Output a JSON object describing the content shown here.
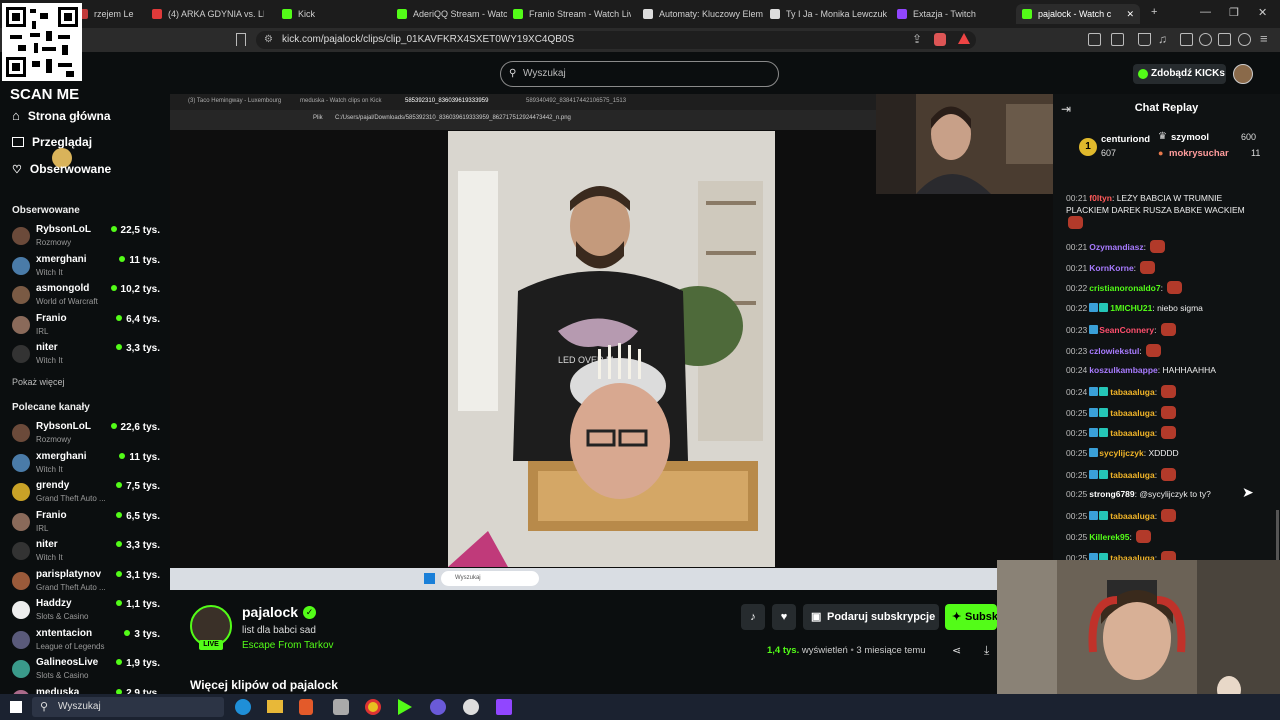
{
  "browser": {
    "tabs": [
      {
        "label": "rzejem Le",
        "color": "#c13b3b"
      },
      {
        "label": "(4) ARKA GDYNIA vs. LECH",
        "color": "#e03a3a"
      },
      {
        "label": "Kick",
        "color": "#53fc18"
      },
      {
        "label": "AderiQQ Stream - Watch L",
        "color": "#53fc18"
      },
      {
        "label": "Franio Stream - Watch Liv",
        "color": "#53fc18"
      },
      {
        "label": "Automaty: Kluczowy Elem",
        "color": "#dddddd"
      },
      {
        "label": "Ty I Ja - Monika Lewczuk",
        "color": "#dddddd"
      },
      {
        "label": "Extazja - Twitch",
        "color": "#9146ff"
      },
      {
        "label": "pajalock - Watch c",
        "color": "#53fc18"
      }
    ],
    "url": "kick.com/pajalock/clips/clip_01KAVFKRX4SXET0WY19XC4QB0S"
  },
  "overlay": {
    "scan_label": "SCAN ME"
  },
  "sidebar": {
    "nav": [
      {
        "label": "Strona główna"
      },
      {
        "label": "Przeglądaj"
      },
      {
        "label": "Obserwowane"
      }
    ],
    "followed_title": "Obserwowane",
    "followed": [
      {
        "name": "RybsonLoL",
        "game": "Rozmowy",
        "count": "22,5 tys.",
        "color": "#6b4a3a"
      },
      {
        "name": "xmerghani",
        "game": "Witch It",
        "count": "11 tys.",
        "color": "#4a7ba8"
      },
      {
        "name": "asmongold",
        "game": "World of Warcraft",
        "count": "10,2 tys.",
        "color": "#7a5a44"
      },
      {
        "name": "Franio",
        "game": "IRL",
        "count": "6,4 tys.",
        "color": "#8a6a5a"
      },
      {
        "name": "niter",
        "game": "Witch It",
        "count": "3,3 tys.",
        "color": "#333333"
      }
    ],
    "show_more": "Pokaż więcej",
    "recommended_title": "Polecane kanały",
    "recommended": [
      {
        "name": "RybsonLoL",
        "game": "Rozmowy",
        "count": "22,6 tys.",
        "color": "#6b4a3a"
      },
      {
        "name": "xmerghani",
        "game": "Witch It",
        "count": "11 tys.",
        "color": "#4a7ba8"
      },
      {
        "name": "grendy",
        "game": "Grand Theft Auto ...",
        "count": "7,5 tys.",
        "color": "#c9a227"
      },
      {
        "name": "Franio",
        "game": "IRL",
        "count": "6,5 tys.",
        "color": "#8a6a5a"
      },
      {
        "name": "niter",
        "game": "Witch It",
        "count": "3,3 tys.",
        "color": "#333333"
      },
      {
        "name": "parisplatynov",
        "game": "Grand Theft Auto ...",
        "count": "3,1 tys.",
        "color": "#9a5a3a"
      },
      {
        "name": "Haddzy",
        "game": "Slots & Casino",
        "count": "1,1 tys.",
        "color": "#eeeeee"
      },
      {
        "name": "xntentacion",
        "game": "League of Legends",
        "count": "3 tys.",
        "color": "#5a5a7a"
      },
      {
        "name": "GalineosLive",
        "game": "Slots & Casino",
        "count": "1,9 tys.",
        "color": "#3a9a8a"
      },
      {
        "name": "meduska",
        "game": "",
        "count": "2,9 tys.",
        "color": "#aa6a8a"
      }
    ]
  },
  "header": {
    "search_placeholder": "Wyszukaj",
    "kicks_label": "Zdobądź KICKs"
  },
  "inner": {
    "tabs": [
      "(3) Taco Hemingway - Luxembourg",
      "meduska - Watch clips on Kick",
      "585392310_836039619333959",
      "589340492_838417442106575_1513"
    ],
    "file_label": "Plik",
    "url": "C:/Users/pajal/Downloads/585392310_836039619333959_862717512924473442_n.png",
    "shirt_text": "LED OVER M",
    "taskbar_search": "Wyszukaj"
  },
  "chat": {
    "title": "Chat Replay",
    "top": [
      {
        "rank": "1",
        "name": "centuriond",
        "amount": "607"
      },
      {
        "name": "szymool",
        "amount": "600"
      },
      {
        "name": "mokrysuchar",
        "amount": "11"
      }
    ],
    "messages": [
      {
        "time": "00:21",
        "user": "f0ltyn",
        "color": "#ff5a5a",
        "text": "LEŻY BABCIA W TRUMNIE",
        "text2": "PLACKIEM DAREK RUSZA BABKE WACKIEM",
        "badges": 0,
        "emote": true
      },
      {
        "time": "00:21",
        "user": "Ozymandiasz",
        "color": "#a87bff",
        "text": "",
        "badges": 0,
        "emote": true
      },
      {
        "time": "00:21",
        "user": "KornKorne",
        "color": "#a87bff",
        "text": "",
        "badges": 0,
        "emote": true
      },
      {
        "time": "00:22",
        "user": "cristianoronaldo7",
        "color": "#53fc18",
        "text": "",
        "badges": 0,
        "emote": true
      },
      {
        "time": "00:22",
        "user": "1MICHU21",
        "color": "#53fc18",
        "text": "niebo sigma",
        "badges": 2,
        "emote": false
      },
      {
        "time": "00:23",
        "user": "SeanConnery",
        "color": "#ff4f6d",
        "text": "",
        "badges": 1,
        "emote": true
      },
      {
        "time": "00:23",
        "user": "czlowiekstul",
        "color": "#a87bff",
        "text": "",
        "badges": 0,
        "emote": true
      },
      {
        "time": "00:24",
        "user": "koszulkambappe",
        "color": "#a87bff",
        "text": "HAHHAAHHA",
        "badges": 0,
        "emote": false
      },
      {
        "time": "00:24",
        "user": "tabaaaluga",
        "color": "#f0b429",
        "text": "",
        "badges": 2,
        "emote": true
      },
      {
        "time": "00:25",
        "user": "tabaaaluga",
        "color": "#f0b429",
        "text": "",
        "badges": 2,
        "emote": true
      },
      {
        "time": "00:25",
        "user": "tabaaaluga",
        "color": "#f0b429",
        "text": "",
        "badges": 2,
        "emote": true
      },
      {
        "time": "00:25",
        "user": "sycylijczyk",
        "color": "#f0b429",
        "text": "XDDDD",
        "badges": 1,
        "emote": false
      },
      {
        "time": "00:25",
        "user": "tabaaaluga",
        "color": "#f0b429",
        "text": "",
        "badges": 2,
        "emote": true
      },
      {
        "time": "00:25",
        "user": "strong6789",
        "color": "#ffffff",
        "text": "@sycylijczyk to ty?",
        "badges": 0,
        "emote": false
      },
      {
        "time": "00:25",
        "user": "tabaaaluga",
        "color": "#f0b429",
        "text": "",
        "badges": 2,
        "emote": true
      },
      {
        "time": "00:25",
        "user": "Killerek95",
        "color": "#53fc18",
        "text": "",
        "badges": 0,
        "emote": true
      },
      {
        "time": "00:25",
        "user": "tabaaaluga",
        "color": "#f0b429",
        "text": "",
        "badges": 2,
        "emote": true
      }
    ]
  },
  "clip": {
    "channel": "pajalock",
    "title": "list dla babci sad",
    "category": "Escape From Tarkov",
    "live_badge": "LIVE",
    "views": "1,4 tys.",
    "views_label": "wyświetleń",
    "age": "3 miesiące temu",
    "gift_label": "Podaruj subskrypcje",
    "sub_label": "Subsk",
    "more_clips": "Więcej klipów od pajalock"
  },
  "taskbar": {
    "search": "Wyszukaj"
  },
  "colors": {
    "accent": "#53fc18",
    "bg": "#0b0e0f",
    "chat_bg": "#0f1213"
  }
}
